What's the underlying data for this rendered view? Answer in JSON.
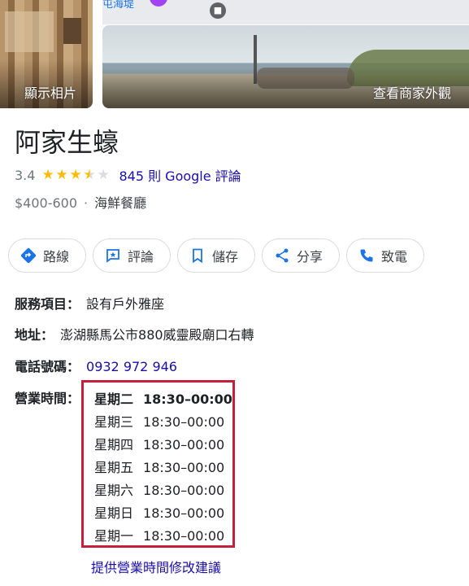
{
  "photos": {
    "left_caption": "顯示相片",
    "right_caption": "查看商家外觀",
    "map_label": "屯海堤"
  },
  "business": {
    "name": "阿家生蠔",
    "rating": "3.4",
    "stars": 3.5,
    "reviews_link": "845 則 Google 評論",
    "price": "$400-600",
    "separator": "·",
    "category": "海鮮餐廳"
  },
  "actions": [
    {
      "label": "路線",
      "icon": "directions-icon"
    },
    {
      "label": "評論",
      "icon": "review-icon"
    },
    {
      "label": "儲存",
      "icon": "bookmark-icon"
    },
    {
      "label": "分享",
      "icon": "share-icon"
    },
    {
      "label": "致電",
      "icon": "phone-icon"
    }
  ],
  "details": {
    "services_label": "服務項目：",
    "services_value": "設有戶外雅座",
    "address_label": "地址：",
    "address_value": "澎湖縣馬公市880威靈殿廟口右轉",
    "phone_label": "電話號碼：",
    "phone_value": "0932 972 946",
    "hours_label": "營業時間："
  },
  "hours": [
    {
      "day": "星期二",
      "time": "18:30–00:00",
      "today": true
    },
    {
      "day": "星期三",
      "time": "18:30–00:00"
    },
    {
      "day": "星期四",
      "time": "18:30–00:00"
    },
    {
      "day": "星期五",
      "time": "18:30–00:00"
    },
    {
      "day": "星期六",
      "time": "18:30–00:00"
    },
    {
      "day": "星期日",
      "time": "18:30–00:00"
    },
    {
      "day": "星期一",
      "time": "18:30–00:00"
    }
  ],
  "suggest_edit": "提供營業時間修改建議",
  "colors": {
    "link": "#1a0dab",
    "star": "#fbbc04",
    "highlight_border": "#c5203b",
    "icon_blue": "#1a73e8"
  }
}
